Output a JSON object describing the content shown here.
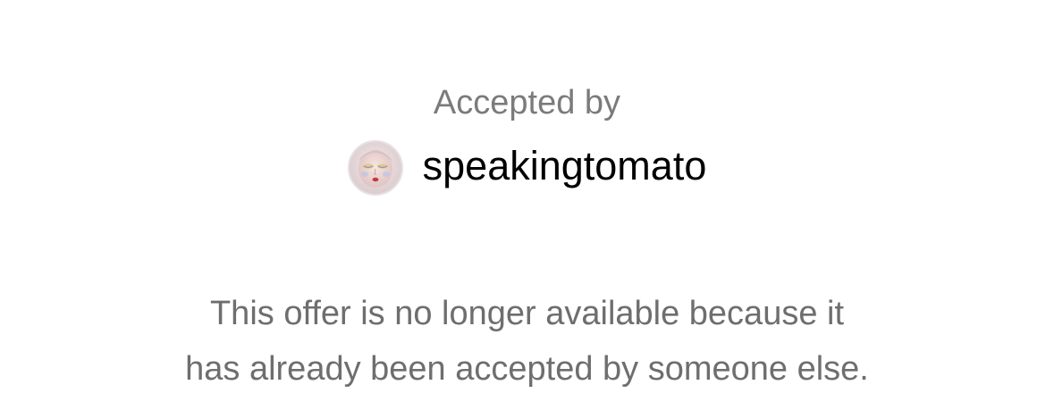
{
  "header": {
    "accepted_label": "Accepted by"
  },
  "user": {
    "username": "speakingtomato",
    "avatar_icon": "portrait-face-avatar"
  },
  "message": {
    "line1": "This offer is no longer available because it",
    "line2": "has already been accepted by someone else."
  },
  "colors": {
    "label_gray": "#7b7b7b",
    "message_gray": "#6e6e6e",
    "username_black": "#000000",
    "background": "#ffffff"
  }
}
